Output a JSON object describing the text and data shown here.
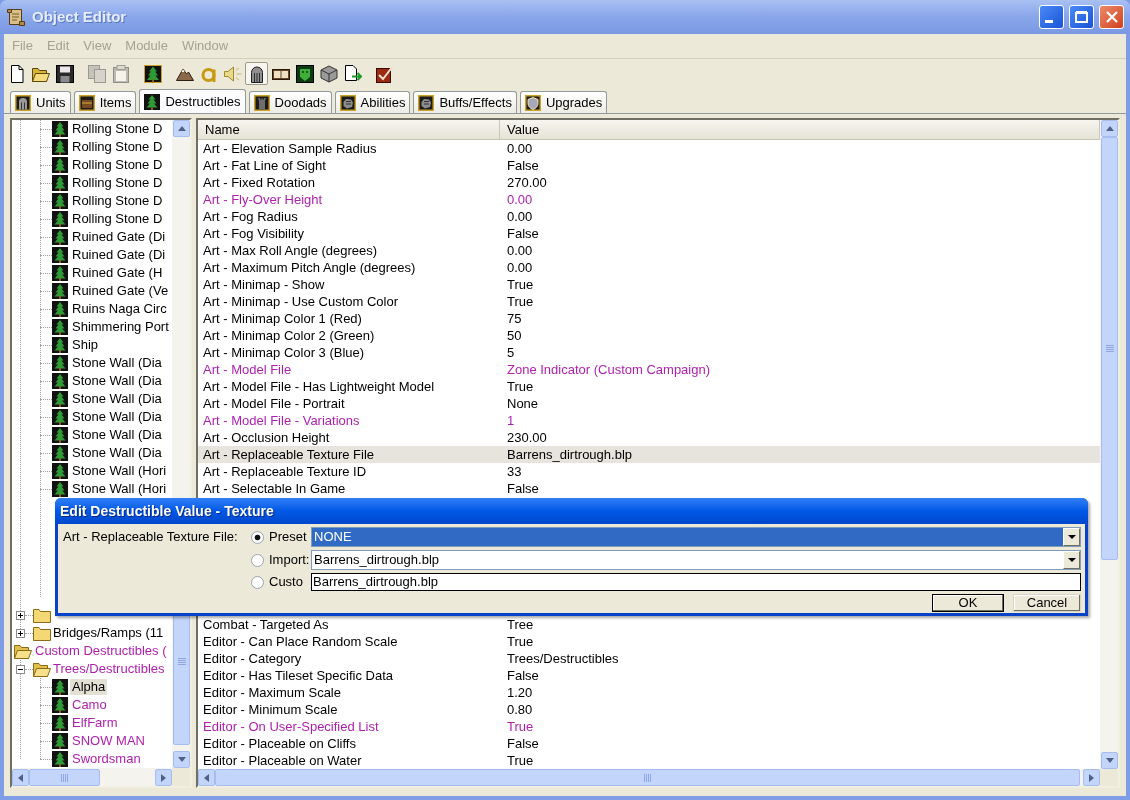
{
  "window": {
    "title": "Object Editor"
  },
  "menu": [
    {
      "label": "File",
      "disabled": true
    },
    {
      "label": "Edit",
      "disabled": true
    },
    {
      "label": "View",
      "disabled": true
    },
    {
      "label": "Module",
      "disabled": true
    },
    {
      "label": "Window",
      "disabled": true
    }
  ],
  "toolbar": {
    "groups": [
      [
        {
          "kind": "new",
          "disabled": false,
          "pressed": false
        },
        {
          "kind": "open",
          "disabled": false,
          "pressed": false
        },
        {
          "kind": "save",
          "disabled": false,
          "pressed": false
        }
      ],
      [
        {
          "kind": "copy",
          "disabled": true,
          "pressed": false
        },
        {
          "kind": "paste",
          "disabled": true,
          "pressed": false
        }
      ],
      [
        {
          "kind": "tree",
          "disabled": false,
          "pressed": false
        }
      ],
      [
        {
          "kind": "terrain",
          "disabled": false,
          "pressed": false
        },
        {
          "kind": "ring",
          "disabled": false,
          "pressed": false
        },
        {
          "kind": "sound",
          "disabled": false,
          "pressed": false
        },
        {
          "kind": "helmet",
          "disabled": false,
          "pressed": true
        },
        {
          "kind": "book",
          "disabled": false,
          "pressed": false
        },
        {
          "kind": "mask",
          "disabled": false,
          "pressed": false
        },
        {
          "kind": "cube",
          "disabled": false,
          "pressed": false
        },
        {
          "kind": "import",
          "disabled": false,
          "pressed": false
        }
      ],
      [
        {
          "kind": "check",
          "disabled": false,
          "pressed": false
        }
      ]
    ]
  },
  "tabs": [
    {
      "label": "Units",
      "kind": "unit",
      "selected": false
    },
    {
      "label": "Items",
      "kind": "item",
      "selected": false
    },
    {
      "label": "Destructibles",
      "kind": "destructible",
      "selected": true
    },
    {
      "label": "Doodads",
      "kind": "doodad",
      "selected": false
    },
    {
      "label": "Abilities",
      "kind": "ability",
      "selected": false
    },
    {
      "label": "Buffs/Effects",
      "kind": "buff",
      "selected": false
    },
    {
      "label": "Upgrades",
      "kind": "upgrade",
      "selected": false
    }
  ],
  "tree": {
    "nodes": [
      {
        "kind": "offscreen",
        "children": [
          {
            "kind": "offscreen",
            "children": [
              {
                "kind": "leaf",
                "label": "Rolling Stone D",
                "selected": false,
                "modified": false
              },
              {
                "kind": "leaf",
                "label": "Rolling Stone D",
                "selected": false,
                "modified": false
              },
              {
                "kind": "leaf",
                "label": "Rolling Stone D",
                "selected": false,
                "modified": false
              },
              {
                "kind": "leaf",
                "label": "Rolling Stone D",
                "selected": false,
                "modified": false
              },
              {
                "kind": "leaf",
                "label": "Rolling Stone D",
                "selected": false,
                "modified": false
              },
              {
                "kind": "leaf",
                "label": "Rolling Stone D",
                "selected": false,
                "modified": false
              },
              {
                "kind": "leaf",
                "label": "Ruined Gate (Di",
                "selected": false,
                "modified": false
              },
              {
                "kind": "leaf",
                "label": "Ruined Gate (Di",
                "selected": false,
                "modified": false
              },
              {
                "kind": "leaf",
                "label": "Ruined Gate (H",
                "selected": false,
                "modified": false
              },
              {
                "kind": "leaf",
                "label": "Ruined Gate (Ve",
                "selected": false,
                "modified": false
              },
              {
                "kind": "leaf",
                "label": "Ruins Naga Circ",
                "selected": false,
                "modified": false
              },
              {
                "kind": "leaf",
                "label": "Shimmering Port",
                "selected": false,
                "modified": false
              },
              {
                "kind": "leaf",
                "label": "Ship",
                "selected": false,
                "modified": false
              },
              {
                "kind": "leaf",
                "label": "Stone Wall (Dia",
                "selected": false,
                "modified": false
              },
              {
                "kind": "leaf",
                "label": "Stone Wall (Dia",
                "selected": false,
                "modified": false
              },
              {
                "kind": "leaf",
                "label": "Stone Wall (Dia",
                "selected": false,
                "modified": false
              },
              {
                "kind": "leaf",
                "label": "Stone Wall (Dia",
                "selected": false,
                "modified": false
              },
              {
                "kind": "leaf",
                "label": "Stone Wall (Dia",
                "selected": false,
                "modified": false
              },
              {
                "kind": "leaf",
                "label": "Stone Wall (Dia",
                "selected": false,
                "modified": false
              },
              {
                "kind": "leaf",
                "label": "Stone Wall (Hori",
                "selected": false,
                "modified": false
              },
              {
                "kind": "leaf",
                "label": "Stone Wall (Hori",
                "selected": false,
                "modified": false
              }
            ]
          },
          {
            "kind": "folder",
            "expanded": false
          },
          {
            "kind": "folder",
            "label": "Bridges/Ramps (11",
            "expanded": false,
            "selected": false,
            "modified": false
          }
        ]
      },
      {
        "kind": "folder",
        "label": "Custom Destructibles (",
        "expanded": true,
        "selected": false,
        "modified": true,
        "children": [
          {
            "kind": "folder",
            "label": "Trees/Destructibles",
            "expanded": true,
            "selected": false,
            "modified": true,
            "children": [
              {
                "kind": "leaf",
                "label": "Alpha",
                "selected": true,
                "modified": false
              },
              {
                "kind": "leaf",
                "label": "Camo",
                "selected": false,
                "modified": true
              },
              {
                "kind": "leaf",
                "label": "ElfFarm",
                "selected": false,
                "modified": true
              },
              {
                "kind": "leaf",
                "label": "SNOW MAN",
                "selected": false,
                "modified": true
              },
              {
                "kind": "leaf",
                "label": "Swordsman",
                "selected": false,
                "modified": true
              }
            ]
          }
        ]
      }
    ]
  },
  "table": {
    "columns": [
      "Name",
      "Value"
    ],
    "rows_above_dialog": [
      {
        "name": "Art - Elevation Sample Radius",
        "value": "0.00",
        "modified": false,
        "selected": false
      },
      {
        "name": "Art - Fat Line of Sight",
        "value": "False",
        "modified": false,
        "selected": false
      },
      {
        "name": "Art - Fixed Rotation",
        "value": "270.00",
        "modified": false,
        "selected": false
      },
      {
        "name": "Art - Fly-Over Height",
        "value": "0.00",
        "modified": true,
        "selected": false
      },
      {
        "name": "Art - Fog Radius",
        "value": "0.00",
        "modified": false,
        "selected": false
      },
      {
        "name": "Art - Fog Visibility",
        "value": "False",
        "modified": false,
        "selected": false
      },
      {
        "name": "Art - Max Roll Angle (degrees)",
        "value": "0.00",
        "modified": false,
        "selected": false
      },
      {
        "name": "Art - Maximum Pitch Angle (degrees)",
        "value": "0.00",
        "modified": false,
        "selected": false
      },
      {
        "name": "Art - Minimap - Show",
        "value": "True",
        "modified": false,
        "selected": false
      },
      {
        "name": "Art - Minimap - Use Custom Color",
        "value": "True",
        "modified": false,
        "selected": false
      },
      {
        "name": "Art - Minimap Color 1 (Red)",
        "value": "75",
        "modified": false,
        "selected": false
      },
      {
        "name": "Art - Minimap Color 2 (Green)",
        "value": "50",
        "modified": false,
        "selected": false
      },
      {
        "name": "Art - Minimap Color 3 (Blue)",
        "value": "5",
        "modified": false,
        "selected": false
      },
      {
        "name": "Art - Model File",
        "value": "Zone Indicator (Custom Campaign)",
        "modified": true,
        "selected": false
      },
      {
        "name": "Art - Model File - Has Lightweight Model",
        "value": "True",
        "modified": false,
        "selected": false
      },
      {
        "name": "Art - Model File - Portrait",
        "value": "None",
        "modified": false,
        "selected": false
      },
      {
        "name": "Art - Model File - Variations",
        "value": "1",
        "modified": true,
        "selected": false
      },
      {
        "name": "Art - Occlusion Height",
        "value": "230.00",
        "modified": false,
        "selected": false
      },
      {
        "name": "Art - Replaceable Texture File",
        "value": "Barrens_dirtrough.blp",
        "modified": false,
        "selected": true
      },
      {
        "name": "Art - Replaceable Texture ID",
        "value": "33",
        "modified": false,
        "selected": false
      },
      {
        "name": "Art - Selectable In Game",
        "value": "False",
        "modified": false,
        "selected": false
      }
    ],
    "rows_below_dialog": [
      {
        "name": "Combat - Targeted As",
        "value": "Tree",
        "modified": false,
        "selected": false
      },
      {
        "name": "Editor - Can Place Random Scale",
        "value": "True",
        "modified": false,
        "selected": false
      },
      {
        "name": "Editor - Category",
        "value": "Trees/Destructibles",
        "modified": false,
        "selected": false
      },
      {
        "name": "Editor - Has Tileset Specific Data",
        "value": "False",
        "modified": false,
        "selected": false
      },
      {
        "name": "Editor - Maximum Scale",
        "value": "1.20",
        "modified": false,
        "selected": false
      },
      {
        "name": "Editor - Minimum Scale",
        "value": "0.80",
        "modified": false,
        "selected": false
      },
      {
        "name": "Editor - On User-Specified List",
        "value": "True",
        "modified": true,
        "selected": false
      },
      {
        "name": "Editor - Placeable on Cliffs",
        "value": "False",
        "modified": false,
        "selected": false
      },
      {
        "name": "Editor - Placeable on Water",
        "value": "True",
        "modified": false,
        "selected": false
      }
    ]
  },
  "dialog": {
    "title": "Edit Destructible Value - Texture",
    "field_label": "Art - Replaceable Texture File:",
    "options": [
      {
        "label": "Preset",
        "selected": true,
        "kind": "dropdown",
        "value": "NONE",
        "focused": true
      },
      {
        "label": "Import:",
        "selected": false,
        "kind": "dropdown",
        "value": "Barrens_dirtrough.blp",
        "focused": false
      },
      {
        "label": "Custo",
        "selected": false,
        "kind": "text",
        "value": "Barrens_dirtrough.blp",
        "focused": false
      }
    ],
    "buttons": [
      {
        "label": "OK",
        "default": true
      },
      {
        "label": "Cancel",
        "default": false
      }
    ]
  }
}
